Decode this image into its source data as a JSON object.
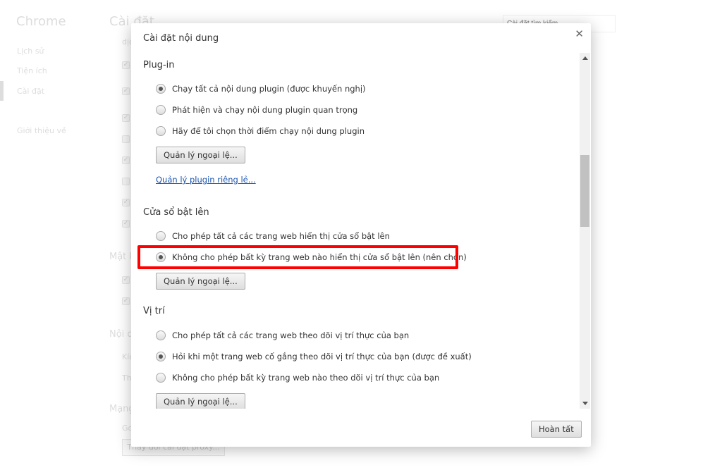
{
  "background": {
    "app_title": "Chrome",
    "nav": [
      "Lịch sử",
      "Tiện ích",
      "Cài đặt",
      "Giới thiệu về"
    ],
    "page_title": "Cài đặt",
    "search_placeholder": "Cài đặt tìm kiếm",
    "fragments": {
      "dich": "dịc",
      "mat": "Mật k",
      "noi": "Nội d",
      "kich": "Kíc",
      "th": "Th",
      "mang": "Mạng",
      "go": "Go"
    },
    "proxy_button": "Thay đổi cài đặt proxy..."
  },
  "dialog": {
    "title": "Cài đặt nội dung",
    "close_icon": "close-icon",
    "sections": [
      {
        "heading": "Plug-in",
        "options": [
          {
            "label": "Chạy tất cả nội dung plugin (được khuyến nghị)",
            "selected": true
          },
          {
            "label": "Phát hiện và chạy nội dung plugin quan trọng",
            "selected": false
          },
          {
            "label": "Hãy để tôi chọn thời điểm chạy nội dung plugin",
            "selected": false
          }
        ],
        "button": "Quản lý ngoại lệ...",
        "link": "Quản lý plugin riêng lẻ..."
      },
      {
        "heading": "Cửa sổ bật lên",
        "options": [
          {
            "label": "Cho phép tất cả các trang web hiển thị cửa sổ bật lên",
            "selected": false
          },
          {
            "label": "Không cho phép bất kỳ trang web nào hiển thị cửa sổ bật lên (nên chọn)",
            "selected": true
          }
        ],
        "button": "Quản lý ngoại lệ..."
      },
      {
        "heading": "Vị trí",
        "options": [
          {
            "label": "Cho phép tất cả các trang web theo dõi vị trí thực của bạn",
            "selected": false
          },
          {
            "label": "Hỏi khi một trang web cố gắng theo dõi vị trí thực của bạn (được đề xuất)",
            "selected": true
          },
          {
            "label": "Không cho phép bất kỳ trang web nào theo dõi vị trí thực của bạn",
            "selected": false
          }
        ],
        "button": "Quản lý ngoại lệ..."
      }
    ],
    "done_button": "Hoàn tất",
    "highlight_color": "#ff0000"
  }
}
